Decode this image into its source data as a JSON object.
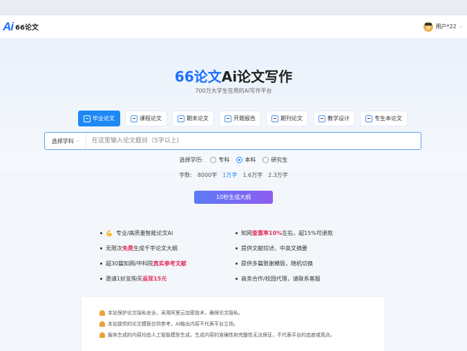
{
  "header": {
    "logo_text": "Ai",
    "brand_name": "66论文",
    "username": "用户*22"
  },
  "hero": {
    "title_brand": "66论文",
    "title_rest": "Ai论文写作",
    "subtitle": "700万大学生在用的AI写作平台"
  },
  "tabs": [
    {
      "label": "毕业论文",
      "active": true
    },
    {
      "label": "课程论文"
    },
    {
      "label": "期末论文"
    },
    {
      "label": "开题报告"
    },
    {
      "label": "期刊论文"
    },
    {
      "label": "教学设计"
    },
    {
      "label": "专生本论文"
    }
  ],
  "search": {
    "subject_label": "选择学科",
    "placeholder": "在这里输入论文题目（5字以上)"
  },
  "education": {
    "label": "选择学历:",
    "options": [
      "专科",
      "本科",
      "研究生"
    ],
    "selected": "本科"
  },
  "word_count": {
    "label": "字数:",
    "options": [
      "8000字",
      "1万字",
      "1.6万字",
      "2.3万字"
    ],
    "selected": "1万字"
  },
  "generate_button": "10秒生成大纲",
  "features": {
    "f1_icon": "💪",
    "f1_text": "专业/高质量智能论文Ai",
    "f2_pre": "知网",
    "f2_hl": "查重率10%",
    "f2_post": "左右，超15%可退款",
    "f3_pre": "无限次",
    "f3_hl": "免费",
    "f3_post": "生成千字论文大纲",
    "f4_text": "提供文献综述、中英文摘要",
    "f5_pre": "超30篇知网/中科院",
    "f5_hl": "真实参考文献",
    "f6_text": "提供多篇致谢模版，随机切换",
    "f7_pre": "邀请1好友购买",
    "f7_hl": "返现15元",
    "f8_text": "商务合作/校园代理，请联系客服"
  },
  "notices": [
    "本站保护论文隐私安全，采用阿里云加密技术，确保论文隐私。",
    "本站提供的论文模板仅供参考，AI输出内容不代表平台立场。",
    "服务生成的内容均由人工智能模型生成，生成内容的准确性和完整性无法保证，不代表平台的态度或观点。"
  ],
  "colors": {
    "accent": "#1e88f5",
    "highlight": "#e4315a",
    "button_start": "#5a7cf5",
    "button_end": "#8f5cf0"
  }
}
